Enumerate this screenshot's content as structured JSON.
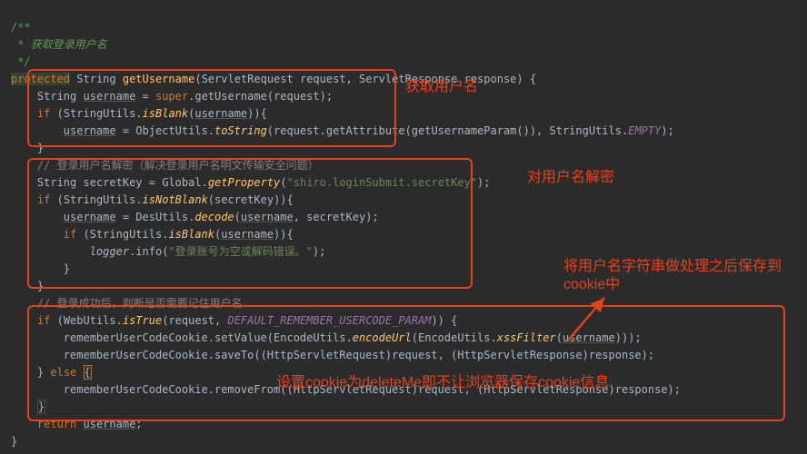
{
  "code": {
    "docComment1": "/**",
    "docComment2": " * 获取登录用户名",
    "docComment3": " */",
    "kw_protected": "protected",
    "kw_super": "super",
    "kw_if": "if",
    "kw_return": "return",
    "kw_else": "else",
    "type_String": "String",
    "param_request": "request",
    "param_response": "response",
    "type_ServletRequest": "ServletRequest",
    "type_ServletResponse": "ServletResponse",
    "m_getUsername": "getUsername",
    "var_username": "username",
    "cls_StringUtils": "StringUtils",
    "m_isBlank": "isBlank",
    "m_isNotBlank": "isNotBlank",
    "cls_ObjectUtils": "ObjectUtils",
    "m_toString": "toString",
    "m_getAttribute": "getAttribute",
    "m_getUsernameParam": "getUsernameParam",
    "const_EMPTY": "EMPTY",
    "comment_decrypt": "// 登录用户名解密（解决登录用户名明文传输安全问题）",
    "var_secretKey": "secretKey",
    "cls_Global": "Global",
    "m_getProperty": "getProperty",
    "str_shiroKey": "\"shiro.loginSubmit.secretKey\"",
    "cls_DesUtils": "DesUtils",
    "m_decode": "decode",
    "var_logger": "logger",
    "m_info": "info",
    "str_logmsg": "\"登录账号为空或解码错误。\"",
    "comment_remember": "// 登录成功后，判断是否需要记住用户名",
    "cls_WebUtils": "WebUtils",
    "m_isTrue": "isTrue",
    "const_DEFAULT_REMEMBER_USERCODE_PARAM": "DEFAULT_REMEMBER_USERCODE_PARAM",
    "var_rememberCookie": "rememberUserCodeCookie",
    "m_setValue": "setValue",
    "cls_EncodeUtils": "EncodeUtils",
    "m_encodeUrl": "encodeUrl",
    "m_xssFilter": "xssFilter",
    "m_saveTo": "saveTo",
    "type_HttpServletRequest": "HttpServletRequest",
    "type_HttpServletResponse": "HttpServletResponse",
    "m_removeFrom": "removeFrom"
  },
  "annotations": {
    "a1": "获取用户名",
    "a2": "对用户名解密",
    "a3": "将用户名字符串做处理之后保存到cookie中",
    "a4": "设置cookie为deleteMe即不让浏览器保存cookie信息"
  }
}
